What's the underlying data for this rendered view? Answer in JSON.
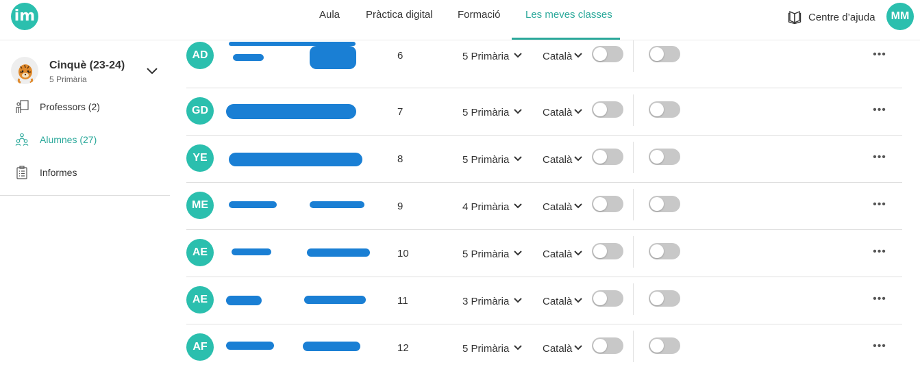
{
  "header": {
    "logo_text": "im",
    "nav": [
      {
        "label": "Aula",
        "active": false
      },
      {
        "label": "Pràctica digital",
        "active": false
      },
      {
        "label": "Formació",
        "active": false
      },
      {
        "label": "Les meves classes",
        "active": true
      }
    ],
    "help_label": "Centre d’ajuda",
    "help_icon": "book-icon",
    "user_initials": "MM"
  },
  "sidebar": {
    "class_name": "Cinquè (23-24)",
    "class_level": "5 Primària",
    "class_avatar_icon": "tiger-icon",
    "items": [
      {
        "label": "Professors (2)",
        "icon": "teacher-icon",
        "active": false
      },
      {
        "label": "Alumnes (27)",
        "icon": "students-icon",
        "active": true
      },
      {
        "label": "Informes",
        "icon": "clipboard-icon",
        "active": false
      }
    ]
  },
  "students": [
    {
      "initials": "AD",
      "number": "6",
      "level": "5 Primària",
      "language": "Català",
      "toggle1": false,
      "toggle2": false
    },
    {
      "initials": "GD",
      "number": "7",
      "level": "5 Primària",
      "language": "Català",
      "toggle1": false,
      "toggle2": false
    },
    {
      "initials": "YE",
      "number": "8",
      "level": "5 Primària",
      "language": "Català",
      "toggle1": false,
      "toggle2": false
    },
    {
      "initials": "ME",
      "number": "9",
      "level": "4 Primària",
      "language": "Català",
      "toggle1": false,
      "toggle2": false
    },
    {
      "initials": "AE",
      "number": "10",
      "level": "5 Primària",
      "language": "Català",
      "toggle1": false,
      "toggle2": false
    },
    {
      "initials": "AE",
      "number": "11",
      "level": "3 Primària",
      "language": "Català",
      "toggle1": false,
      "toggle2": false
    },
    {
      "initials": "AF",
      "number": "12",
      "level": "5 Primària",
      "language": "Català",
      "toggle1": false,
      "toggle2": false
    }
  ],
  "colors": {
    "accent": "#2bbfae",
    "accent_text": "#2aa89a",
    "redaction": "#1a7fd4",
    "toggle_off": "#c8c8c8"
  }
}
